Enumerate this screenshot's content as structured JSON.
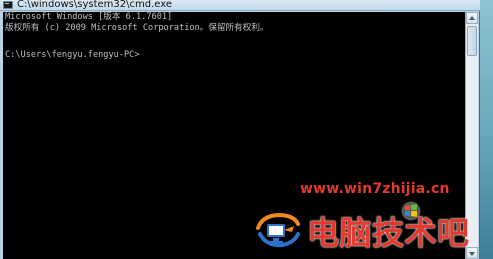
{
  "window": {
    "title": "C:\\windows\\system32\\cmd.exe"
  },
  "console": {
    "lines": [
      "Microsoft Windows [版本 6.1.7601]",
      "版权所有 (c) 2009 Microsoft Corporation。保留所有权利。",
      "",
      "C:\\Users\\fengyu.fengyu-PC>"
    ]
  },
  "watermark": {
    "url": "www.win7zhijia.cn",
    "brand": "电脑技术吧",
    "colors": {
      "accent": "#e23a2e",
      "logo_blue": "#2b74c9",
      "logo_orange": "#f08a1c"
    }
  },
  "colors": {
    "console_bg": "#000000",
    "console_text": "#c0c0c0",
    "titlebar": "#c2d9ea"
  }
}
